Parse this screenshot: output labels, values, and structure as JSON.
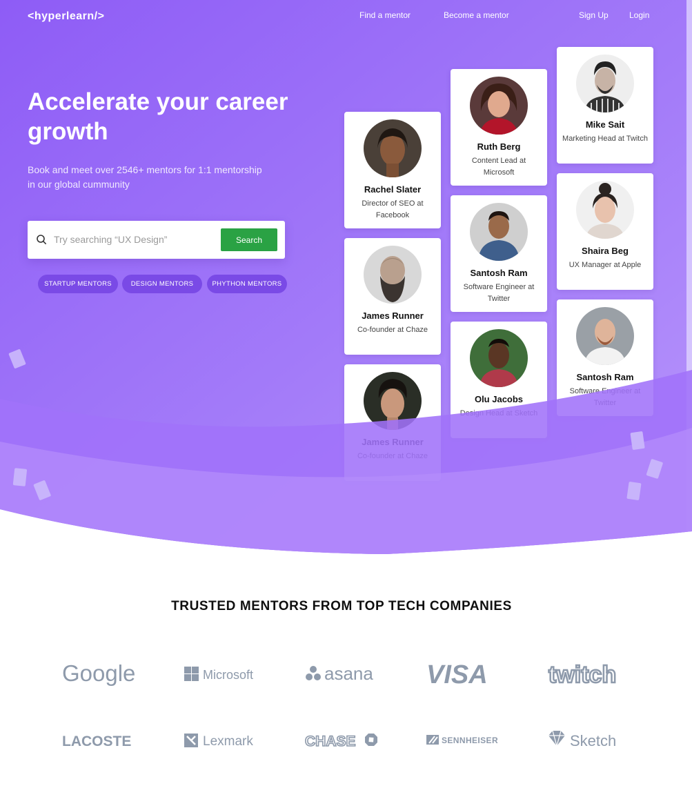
{
  "nav": {
    "logo": "<hyperlearn/>",
    "find_mentor": "Find a mentor",
    "become_mentor": "Become a mentor",
    "signup": "Sign Up",
    "login": "Login"
  },
  "hero": {
    "headline": "Accelerate your career growth",
    "subtext": "Book and meet over 2546+ mentors for 1:1 mentorship in our global cummunity"
  },
  "search": {
    "placeholder": "Try searching “UX Design”",
    "button_label": "Search"
  },
  "tags": [
    "STARTUP MENTORS",
    "DESIGN MENTORS",
    "PHYTHON MENTORS"
  ],
  "mentors": [
    {
      "name": "Rachel Slater",
      "role": "Director of SEO at Facebook"
    },
    {
      "name": "James Runner",
      "role": "Co-founder at Chaze"
    },
    {
      "name": "James Runner",
      "role": "Co-founder at Chaze"
    },
    {
      "name": "Ruth Berg",
      "role": "Content Lead at Microsoft"
    },
    {
      "name": "Santosh Ram",
      "role": "Software Engineer at Twitter"
    },
    {
      "name": "Olu Jacobs",
      "role": "Design Head at Sketch"
    },
    {
      "name": "Mike Sait",
      "role": "Marketing Head at Twitch"
    },
    {
      "name": "Shaira Beg",
      "role": "UX Manager at Apple"
    },
    {
      "name": "Santosh Ram",
      "role": "Software Engineer at Twitter"
    }
  ],
  "trusted": {
    "heading": "TRUSTED MENTORS FROM TOP TECH COMPANIES",
    "logos": [
      "Google",
      "Microsoft",
      "asana",
      "VISA",
      "twitch",
      "LACOSTE",
      "Lexmark",
      "CHASE",
      "SENNHEISER",
      "Sketch"
    ]
  },
  "colors": {
    "hero_purple": "#9563f7",
    "search_green": "#2aa244",
    "tag_purple": "#7a4ae6",
    "logo_gray": "#8e9aab"
  }
}
